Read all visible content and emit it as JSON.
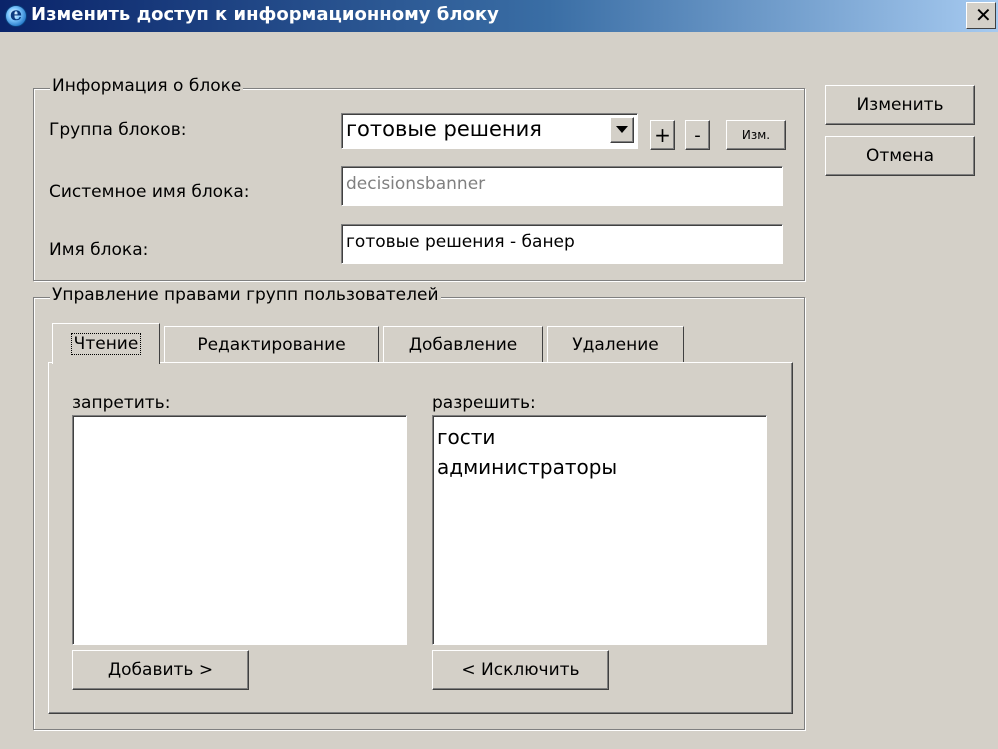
{
  "window": {
    "title": "Изменить доступ к информационному блоку",
    "close_label": "✕"
  },
  "buttons": {
    "ok_label": "Изменить",
    "cancel_label": "Отмена"
  },
  "block_info": {
    "legend": "Информация о блоке",
    "group_label": "Группа блоков:",
    "group_value": "готовые решения",
    "add_group_label": "+",
    "remove_group_label": "-",
    "edit_group_label": "Изм.",
    "sysname_label": "Системное имя блока:",
    "sysname_value": "decisionsbanner",
    "name_label": "Имя блока:",
    "name_value": "готовые решения - банер"
  },
  "rights": {
    "legend": "Управление правами групп пользователей",
    "tabs": [
      {
        "label": "Чтение",
        "active": true
      },
      {
        "label": "Редактирование",
        "active": false
      },
      {
        "label": "Добавление",
        "active": false
      },
      {
        "label": "Удаление",
        "active": false
      }
    ],
    "deny_label": "запретить:",
    "allow_label": "разрешить:",
    "deny_items": [],
    "allow_items": [
      "гости",
      "администраторы"
    ],
    "add_label": "Добавить >",
    "exclude_label": "< Исключить"
  },
  "colors": {
    "titlebar_start": "#0a246a",
    "titlebar_end": "#a6caf0",
    "face": "#d4d0c8"
  },
  "icons": {
    "title": "ie-globe-icon",
    "close": "close-icon",
    "dropdown": "dropdown-arrow-icon"
  }
}
